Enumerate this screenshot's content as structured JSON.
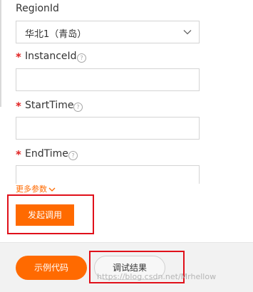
{
  "form": {
    "region": {
      "label": "RegionId",
      "value": "华北1（青岛）"
    },
    "instance_id": {
      "required_mark": "*",
      "label": "InstanceId",
      "help_icon": "question-circle-icon",
      "value": ""
    },
    "start_time": {
      "required_mark": "*",
      "label": "StartTime",
      "help_icon": "question-circle-icon",
      "value": ""
    },
    "end_time": {
      "required_mark": "*",
      "label": "EndTime",
      "help_icon": "question-circle-icon",
      "value": ""
    },
    "more_params": {
      "label": "更多参数",
      "icon": "chevron-down-icon"
    },
    "invoke_button": "发起调用"
  },
  "footer": {
    "sample_code_button": "示例代码",
    "debug_result_button": "调试结果"
  },
  "watermark": "https://blog.csdn.net/Mrhellow",
  "colors": {
    "accent": "#ff6a00",
    "required": "#e02020",
    "highlight_box": "#e0101a",
    "footer_bg": "#f2f2f2"
  }
}
